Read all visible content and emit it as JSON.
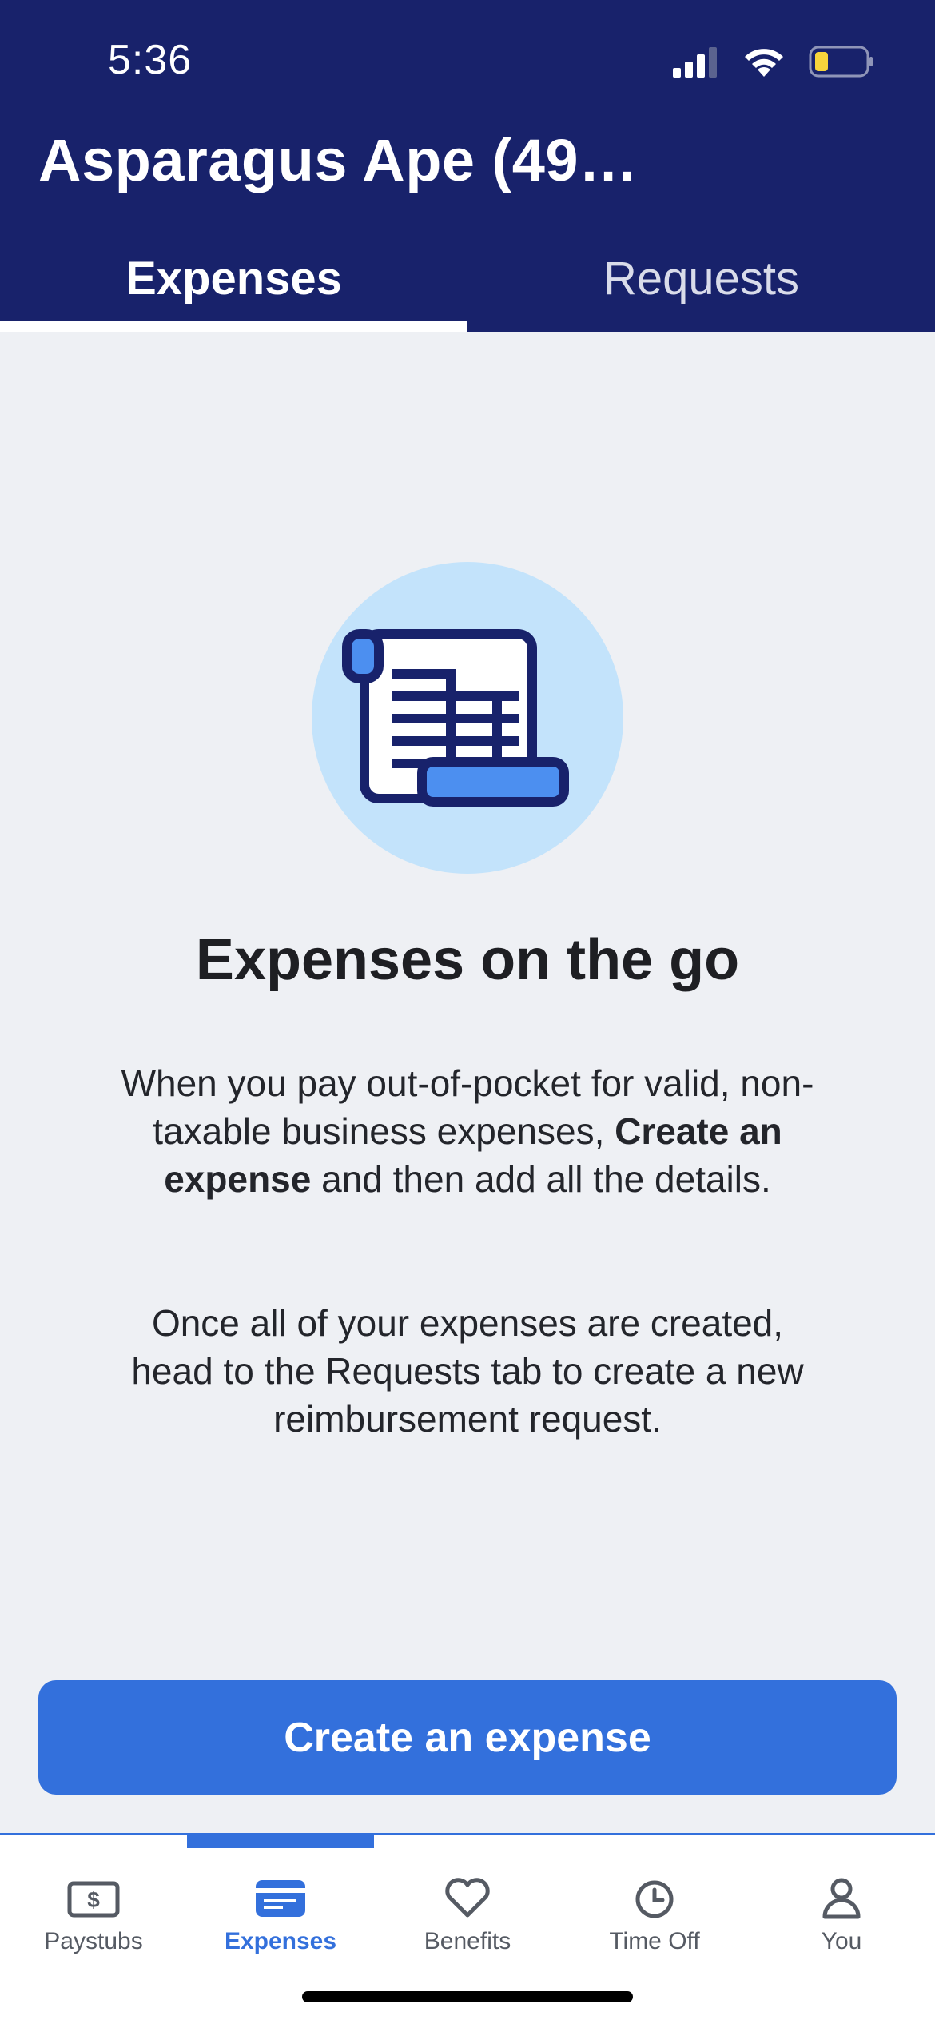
{
  "status_bar": {
    "time": "5:36"
  },
  "header": {
    "title": "Asparagus Ape (49…"
  },
  "tabs": [
    {
      "label": "Expenses",
      "active": true
    },
    {
      "label": "Requests",
      "active": false
    }
  ],
  "empty_state": {
    "icon": "receipt-scroll-icon",
    "headline": "Expenses on the go",
    "paragraph1_start": "When you pay out-of-pocket for valid, non-taxable business expenses, ",
    "paragraph1_bold": "Create an expense",
    "paragraph1_end": " and then add all the details.",
    "paragraph2": "Once all of your expenses are created, head to the Requests tab to create a new reimbursement request."
  },
  "cta": {
    "label": "Create an expense"
  },
  "bottom_nav": [
    {
      "label": "Paystubs",
      "icon": "paystub-icon",
      "active": false
    },
    {
      "label": "Expenses",
      "icon": "expenses-icon",
      "active": true
    },
    {
      "label": "Benefits",
      "icon": "heart-icon",
      "active": false
    },
    {
      "label": "Time Off",
      "icon": "clock-icon",
      "active": false
    },
    {
      "label": "You",
      "icon": "person-icon",
      "active": false
    }
  ],
  "colors": {
    "header_bg": "#18226b",
    "accent": "#3370dc",
    "illustration_bg": "#c3e3fb",
    "page_bg": "#eef0f4"
  }
}
